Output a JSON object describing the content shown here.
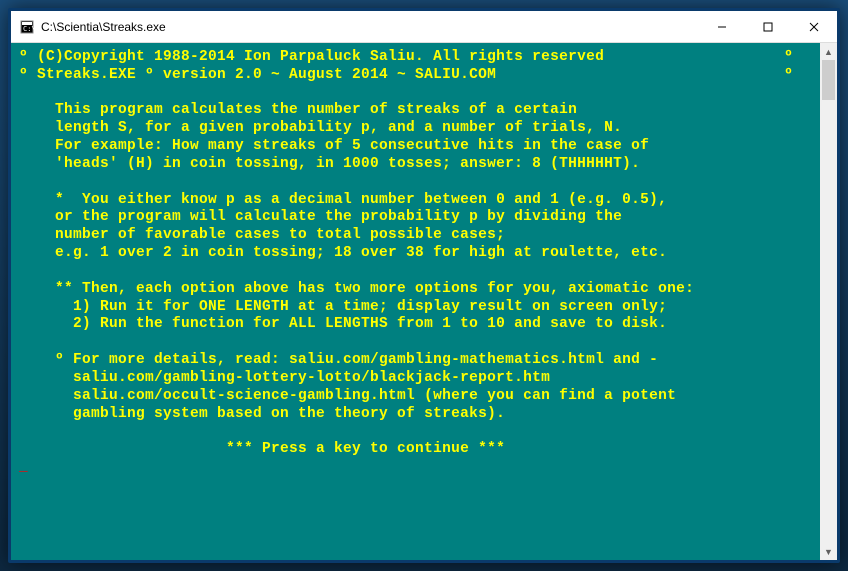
{
  "window": {
    "title": "C:\\Scientia\\Streaks.exe"
  },
  "console": {
    "line1_left": "º (C)Copyright 1988-2014 Ion Parpaluck Saliu. All rights reserved",
    "line1_right": "º",
    "line2_left": "º Streaks.EXE º version 2.0 ~ August 2014 ~ SALIU.COM",
    "line2_right": "º",
    "para1_l1": "    This program calculates the number of streaks of a certain",
    "para1_l2": "    length S, for a given probability p, and a number of trials, N.",
    "para1_l3": "    For example: How many streaks of 5 consecutive hits in the case of",
    "para1_l4": "    'heads' (H) in coin tossing, in 1000 tosses; answer: 8 (THHHHHT).",
    "para2_l1": "    *  You either know p as a decimal number between 0 and 1 (e.g. 0.5),",
    "para2_l2": "    or the program will calculate the probability p by dividing the",
    "para2_l3": "    number of favorable cases to total possible cases;",
    "para2_l4": "    e.g. 1 over 2 in coin tossing; 18 over 38 for high at roulette, etc.",
    "para3_l1": "    ** Then, each option above has two more options for you, axiomatic one:",
    "para3_l2": "      1) Run it for ONE LENGTH at a time; display result on screen only;",
    "para3_l3": "      2) Run the function for ALL LENGTHS from 1 to 10 and save to disk.",
    "para4_l1": "    º For more details, read: saliu.com/gambling-mathematics.html and -",
    "para4_l2": "      saliu.com/gambling-lottery-lotto/blackjack-report.htm",
    "para4_l3": "      saliu.com/occult-science-gambling.html (where you can find a potent",
    "para4_l4": "      gambling system based on the theory of streaks).",
    "continue_line": "                       *** Press a key to continue ***",
    "cursor": "_"
  },
  "controls": {
    "minimize": "—",
    "maximize": "☐",
    "close": "✕"
  }
}
